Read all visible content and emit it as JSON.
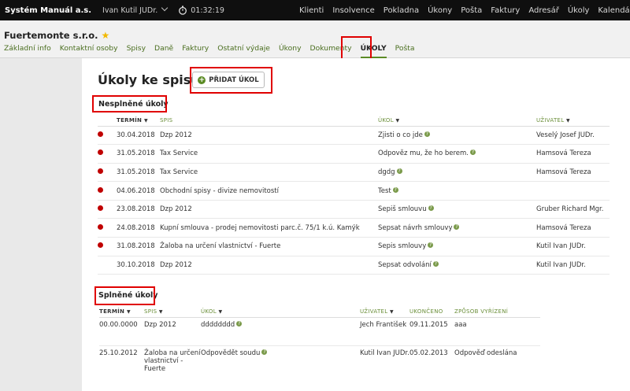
{
  "topbar": {
    "brand": "Systém Manuál a.s.",
    "user": "Ivan Kutil JUDr.",
    "timer": "01:32:19",
    "nav": [
      "Klienti",
      "Insolvence",
      "Pokladna",
      "Úkony",
      "Pošta",
      "Faktury",
      "Adresář",
      "Úkoly",
      "Kalendář"
    ]
  },
  "header": {
    "client_name": "Fuertemonte s.r.o.",
    "tabs": [
      "Základní info",
      "Kontaktní osoby",
      "Spisy",
      "Daně",
      "Faktury",
      "Ostatní výdaje",
      "Úkony",
      "Dokumenty",
      "ÚKOLY",
      "Pošta"
    ]
  },
  "page": {
    "title": "Úkoly ke spisu",
    "add_button": "PŘIDAT ÚKOL"
  },
  "open_tasks": {
    "title": "Nesplněné úkoly",
    "headers": [
      "TERMÍN",
      "SPIS",
      "ÚKOL",
      "UŽIVATEL"
    ],
    "rows": [
      {
        "overdue": true,
        "date": "30.04.2018",
        "case": "Dzp 2012",
        "task": "Zjisti o co jde",
        "user": "Veselý Josef JUDr."
      },
      {
        "overdue": true,
        "date": "31.05.2018",
        "case": "Tax Service",
        "task": "Odpověz mu, že ho berem.",
        "user": "Hamsová Tereza"
      },
      {
        "overdue": true,
        "date": "31.05.2018",
        "case": "Tax Service",
        "task": "dgdg",
        "user": "Hamsová Tereza"
      },
      {
        "overdue": true,
        "date": "04.06.2018",
        "case": "Obchodní spisy - divize nemovitostí",
        "task": "Test",
        "user": ""
      },
      {
        "overdue": true,
        "date": "23.08.2018",
        "case": "Dzp 2012",
        "task": "Sepiš smlouvu",
        "user": "Gruber Richard Mgr."
      },
      {
        "overdue": true,
        "date": "24.08.2018",
        "case": "Kupní smlouva - prodej nemovitosti parc.č. 75/1 k.ú. Kamýk",
        "task": "Sepsat návrh smlouvy",
        "user": "Hamsová Tereza"
      },
      {
        "overdue": true,
        "date": "31.08.2018",
        "case": "Žaloba na určení vlastnictví - Fuerte",
        "task": "Sepis smlouvy",
        "user": "Kutil Ivan JUDr."
      },
      {
        "overdue": false,
        "date": "30.10.2018",
        "case": "Dzp 2012",
        "task": "Sepsat odvolání",
        "user": "Kutil Ivan JUDr."
      }
    ]
  },
  "done_tasks": {
    "title": "Splněné úkoly",
    "headers": [
      "TERMÍN",
      "SPIS",
      "ÚKOL",
      "UŽIVATEL",
      "UKONČENO",
      "ZPŮSOB VYŘÍZENÍ"
    ],
    "rows": [
      {
        "date": "00.00.0000",
        "case": "Dzp 2012",
        "task": "dddddddd",
        "user": "Jech František",
        "finished": "09.11.2015",
        "resolution": "aaa"
      },
      {
        "date": "25.10.2012",
        "case": "Žaloba na určení vlastnictví - Fuerte",
        "task": "Odpovědět soudu",
        "user": "Kutil Ivan JUDr.",
        "finished": "05.02.2013",
        "resolution": "Odpověď odeslána"
      }
    ]
  },
  "colors": {
    "accent": "#5b8b25",
    "highlight": "#e00000",
    "overdue": "#c00000"
  }
}
